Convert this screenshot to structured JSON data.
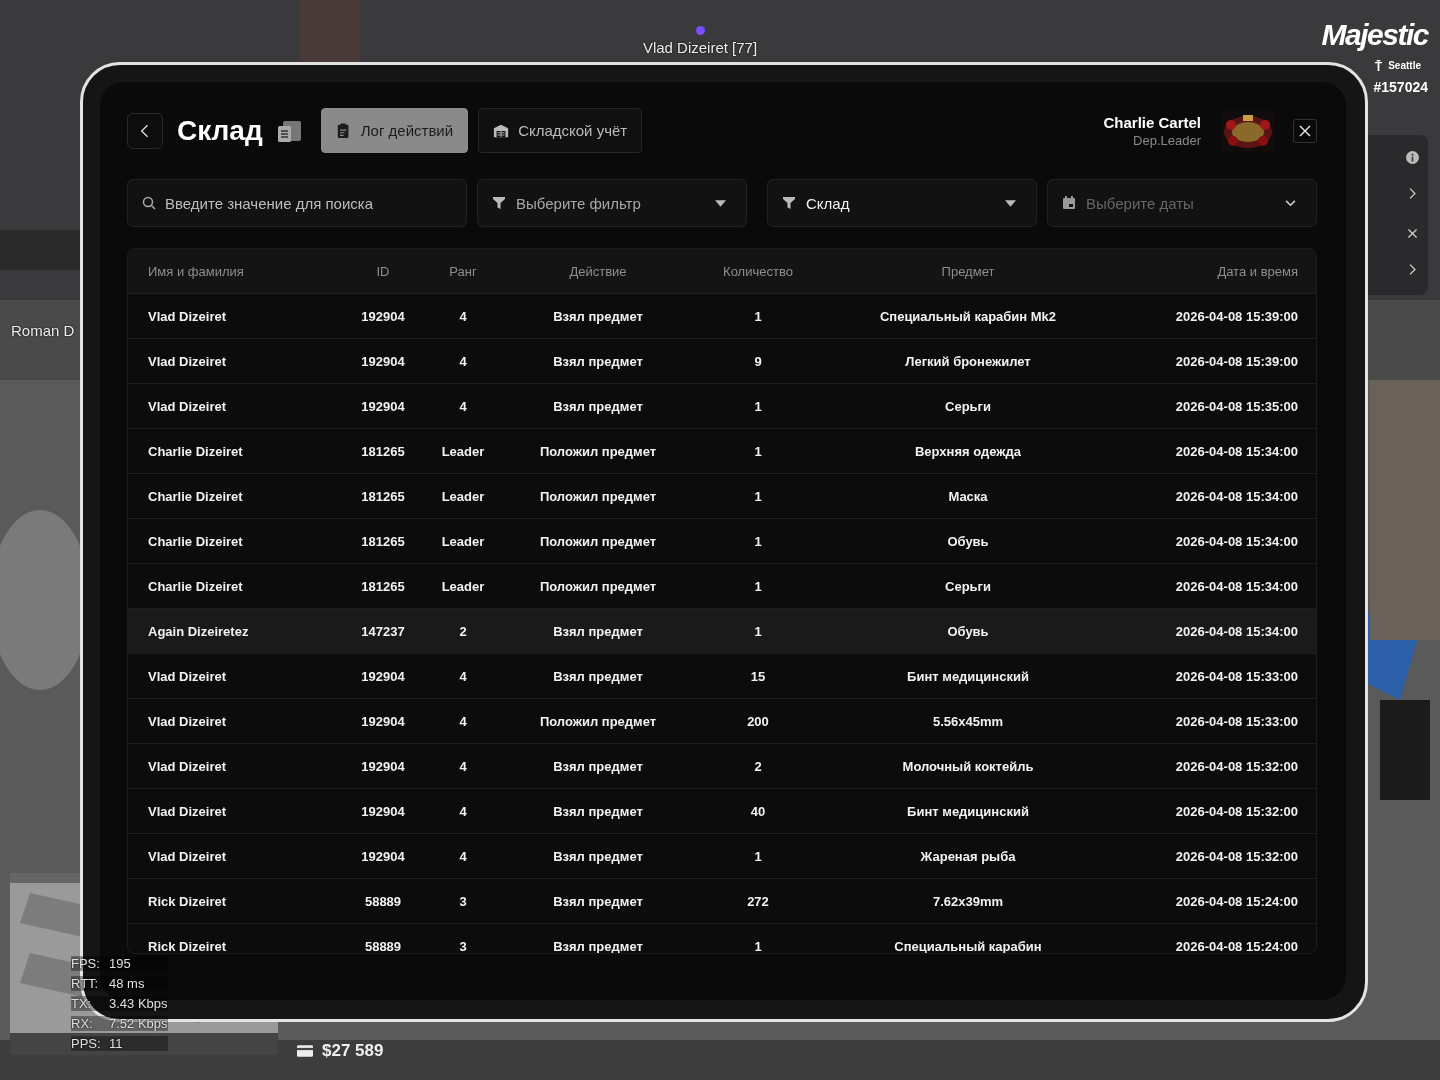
{
  "hud": {
    "brand": "Majestic",
    "city": "Seattle",
    "player_id": "#157024",
    "nametag": "Vlad Dizeiret [77]",
    "side_label": "Roman D",
    "balance": "$27 589",
    "stats": [
      {
        "label": "FPS:",
        "value": "195"
      },
      {
        "label": "RTT:",
        "value": "48 ms"
      },
      {
        "label": "TX:",
        "value": "3.43 Kbps"
      },
      {
        "label": "RX:",
        "value": "7.52 Kbps"
      },
      {
        "label": "PPS:",
        "value": "11"
      }
    ]
  },
  "window": {
    "title": "Склад",
    "tabs": [
      {
        "label": "Лог действий",
        "kind": "log",
        "selected": true
      },
      {
        "label": "Складской учёт",
        "kind": "stock",
        "selected": false
      }
    ],
    "user": {
      "name": "Charlie Cartel",
      "role": "Dep.Leader"
    }
  },
  "filters": {
    "search": {
      "placeholder": "Введите значение для поиска"
    },
    "dropdowns": [
      {
        "kind": "filter",
        "placeholder": "Выберите фильтр"
      },
      {
        "kind": "filter",
        "value": "Склад"
      },
      {
        "kind": "date",
        "placeholder": "Выберите даты"
      }
    ]
  },
  "table": {
    "columns": [
      "Имя и фамилия",
      "ID",
      "Ранг",
      "Действие",
      "Количество",
      "Предмет",
      "Дата и время"
    ],
    "rows": [
      {
        "selected": false,
        "cells": [
          "Vlad Dizeiret",
          "192904",
          "4",
          "Взял предмет",
          "1",
          "Специальный карабин Mk2",
          "2026-04-08 15:39:00"
        ]
      },
      {
        "selected": false,
        "cells": [
          "Vlad Dizeiret",
          "192904",
          "4",
          "Взял предмет",
          "9",
          "Легкий бронежилет",
          "2026-04-08 15:39:00"
        ]
      },
      {
        "selected": false,
        "cells": [
          "Vlad Dizeiret",
          "192904",
          "4",
          "Взял предмет",
          "1",
          "Серьги",
          "2026-04-08 15:35:00"
        ]
      },
      {
        "selected": false,
        "cells": [
          "Charlie Dizeiret",
          "181265",
          "Leader",
          "Положил предмет",
          "1",
          "Верхняя одежда",
          "2026-04-08 15:34:00"
        ]
      },
      {
        "selected": false,
        "cells": [
          "Charlie Dizeiret",
          "181265",
          "Leader",
          "Положил предмет",
          "1",
          "Маска",
          "2026-04-08 15:34:00"
        ]
      },
      {
        "selected": false,
        "cells": [
          "Charlie Dizeiret",
          "181265",
          "Leader",
          "Положил предмет",
          "1",
          "Обувь",
          "2026-04-08 15:34:00"
        ]
      },
      {
        "selected": false,
        "cells": [
          "Charlie Dizeiret",
          "181265",
          "Leader",
          "Положил предмет",
          "1",
          "Серьги",
          "2026-04-08 15:34:00"
        ]
      },
      {
        "selected": true,
        "cells": [
          "Again Dizeiretez",
          "147237",
          "2",
          "Взял предмет",
          "1",
          "Обувь",
          "2026-04-08 15:34:00"
        ]
      },
      {
        "selected": false,
        "cells": [
          "Vlad Dizeiret",
          "192904",
          "4",
          "Взял предмет",
          "15",
          "Бинт медицинский",
          "2026-04-08 15:33:00"
        ]
      },
      {
        "selected": false,
        "cells": [
          "Vlad Dizeiret",
          "192904",
          "4",
          "Положил предмет",
          "200",
          "5.56x45mm",
          "2026-04-08 15:33:00"
        ]
      },
      {
        "selected": false,
        "cells": [
          "Vlad Dizeiret",
          "192904",
          "4",
          "Взял предмет",
          "2",
          "Молочный коктейль",
          "2026-04-08 15:32:00"
        ]
      },
      {
        "selected": false,
        "cells": [
          "Vlad Dizeiret",
          "192904",
          "4",
          "Взял предмет",
          "40",
          "Бинт медицинский",
          "2026-04-08 15:32:00"
        ]
      },
      {
        "selected": false,
        "cells": [
          "Vlad Dizeiret",
          "192904",
          "4",
          "Взял предмет",
          "1",
          "Жареная рыба",
          "2026-04-08 15:32:00"
        ]
      },
      {
        "selected": false,
        "cells": [
          "Rick Dizeiret",
          "58889",
          "3",
          "Взял предмет",
          "272",
          "7.62x39mm",
          "2026-04-08 15:24:00"
        ]
      },
      {
        "selected": false,
        "cells": [
          "Rick Dizeiret",
          "58889",
          "3",
          "Взял предмет",
          "1",
          "Специальный карабин",
          "2026-04-08 15:24:00"
        ]
      }
    ]
  }
}
